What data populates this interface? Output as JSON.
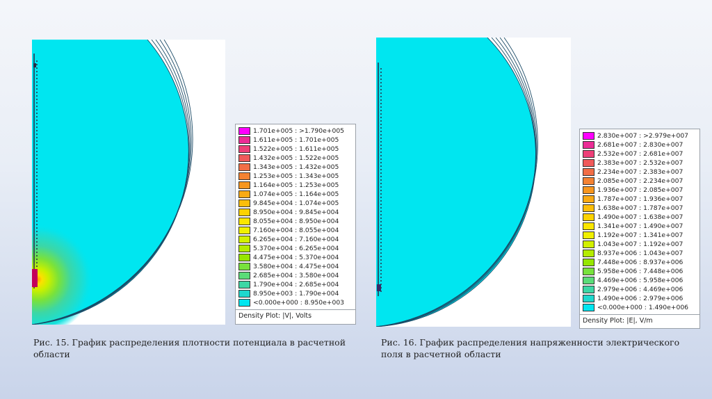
{
  "figures": [
    {
      "caption": "Рис. 15. График распределения плотности потенциала в расчетной области",
      "legend_title": "Density Plot: |V|, Volts",
      "legend": [
        {
          "label": "1.701e+005 : >1.790e+005",
          "color": "#ff00ff"
        },
        {
          "label": "1.611e+005 : 1.701e+005",
          "color": "#ec2c96"
        },
        {
          "label": "1.522e+005 : 1.611e+005",
          "color": "#ee3f78"
        },
        {
          "label": "1.432e+005 : 1.522e+005",
          "color": "#f05a5a"
        },
        {
          "label": "1.343e+005 : 1.432e+005",
          "color": "#f26e46"
        },
        {
          "label": "1.253e+005 : 1.343e+005",
          "color": "#f48232"
        },
        {
          "label": "1.164e+005 : 1.253e+005",
          "color": "#f7961e"
        },
        {
          "label": "1.074e+005 : 1.164e+005",
          "color": "#f9aa14"
        },
        {
          "label": "9.845e+004 : 1.074e+005",
          "color": "#fbbe0a"
        },
        {
          "label": "8.950e+004 : 9.845e+004",
          "color": "#fdd200"
        },
        {
          "label": "8.055e+004 : 8.950e+004",
          "color": "#fbe600"
        },
        {
          "label": "7.160e+004 : 8.055e+004",
          "color": "#f0f000"
        },
        {
          "label": "6.265e+004 : 7.160e+004",
          "color": "#d2f000"
        },
        {
          "label": "5.370e+004 : 6.265e+004",
          "color": "#b4ec00"
        },
        {
          "label": "4.475e+004 : 5.370e+004",
          "color": "#96e600"
        },
        {
          "label": "3.580e+004 : 4.475e+004",
          "color": "#78e23c"
        },
        {
          "label": "2.685e+004 : 3.580e+004",
          "color": "#5adc78"
        },
        {
          "label": "1.790e+004 : 2.685e+004",
          "color": "#3cd7a5"
        },
        {
          "label": "8.950e+003 : 1.790e+004",
          "color": "#1ed8cd"
        },
        {
          "label": "<0.000e+000 : 8.950e+003",
          "color": "#00e6f0"
        }
      ]
    },
    {
      "caption": "Рис. 16. График распределения напряженности электрического поля в расчетной области",
      "legend_title": "Density Plot: |E|, V/m",
      "legend": [
        {
          "label": "2.830e+007 : >2.979e+007",
          "color": "#ff00ff"
        },
        {
          "label": "2.681e+007 : 2.830e+007",
          "color": "#ec2c96"
        },
        {
          "label": "2.532e+007 : 2.681e+007",
          "color": "#ee3f78"
        },
        {
          "label": "2.383e+007 : 2.532e+007",
          "color": "#f05a5a"
        },
        {
          "label": "2.234e+007 : 2.383e+007",
          "color": "#f26e46"
        },
        {
          "label": "2.085e+007 : 2.234e+007",
          "color": "#f48232"
        },
        {
          "label": "1.936e+007 : 2.085e+007",
          "color": "#f7961e"
        },
        {
          "label": "1.787e+007 : 1.936e+007",
          "color": "#f9aa14"
        },
        {
          "label": "1.638e+007 : 1.787e+007",
          "color": "#fbbe0a"
        },
        {
          "label": "1.490e+007 : 1.638e+007",
          "color": "#fdd200"
        },
        {
          "label": "1.341e+007 : 1.490e+007",
          "color": "#fbe600"
        },
        {
          "label": "1.192e+007 : 1.341e+007",
          "color": "#f0f000"
        },
        {
          "label": "1.043e+007 : 1.192e+007",
          "color": "#d2f000"
        },
        {
          "label": "8.937e+006 : 1.043e+007",
          "color": "#b4ec00"
        },
        {
          "label": "7.448e+006 : 8.937e+006",
          "color": "#96e600"
        },
        {
          "label": "5.958e+006 : 7.448e+006",
          "color": "#78e23c"
        },
        {
          "label": "4.469e+006 : 5.958e+006",
          "color": "#5adc78"
        },
        {
          "label": "2.979e+006 : 4.469e+006",
          "color": "#3cd7a5"
        },
        {
          "label": "1.490e+006 : 2.979e+006",
          "color": "#1ed8cd"
        },
        {
          "label": "<0.000e+000 : 1.490e+006",
          "color": "#00e6f0"
        }
      ]
    }
  ]
}
